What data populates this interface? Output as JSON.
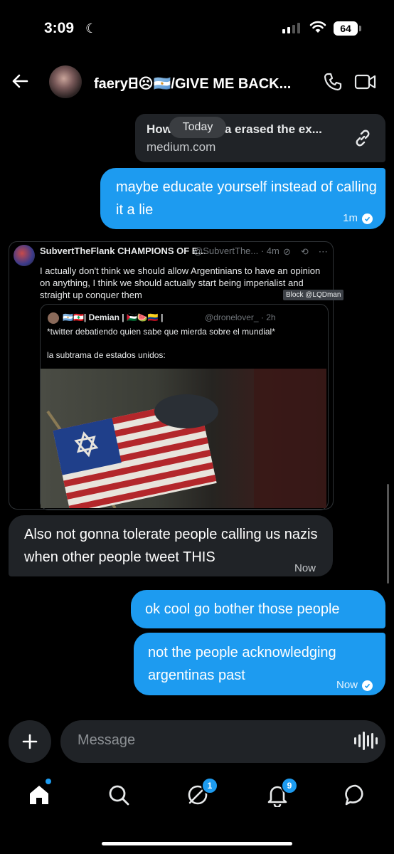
{
  "status_bar": {
    "time": "3:09",
    "battery": "64"
  },
  "header": {
    "contact_name": "faery𐊧☹🇦🇷/GIVE ME BACK..."
  },
  "messages": {
    "link_card": {
      "title": "How Argentina erased the ex...",
      "domain": "medium.com"
    },
    "date_divider": "Today",
    "sent_1": {
      "text": "maybe educate yourself instead of calling it a lie",
      "time": "1m"
    },
    "quoted_tweet": {
      "author": "SubvertTheFlank CHAMPIONS OF E...",
      "handle": "@SubvertThe... · 4m",
      "body": "I actually don't think we should allow Argentinians to have an opinion on anything, I think we should actually start being imperialist and straight up conquer them",
      "block_label": "Block @LQDman",
      "inner": {
        "author": "🇦🇷🇱🇧| Demian | 🇵🇸🍉🇨🇴 |",
        "handle": "@dronelover_ · 2h",
        "line1": "*twitter debatiendo quien sabe que mierda sobre el mundial*",
        "line2": "la subtrama de estados unidos:"
      }
    },
    "received_1": {
      "text": "Also not gonna tolerate people calling us nazis when other people tweet THIS",
      "time": "Now"
    },
    "sent_2": {
      "text": "ok cool go bother those people"
    },
    "sent_3": {
      "text": "not the people acknowledging argentinas past",
      "time": "Now"
    }
  },
  "composer": {
    "placeholder": "Message"
  },
  "bottom_nav": {
    "grok_badge": "1",
    "notifications_badge": "9"
  },
  "colors": {
    "accent": "#1d9bf0",
    "bubble_gray": "#202327",
    "background": "#000000"
  }
}
